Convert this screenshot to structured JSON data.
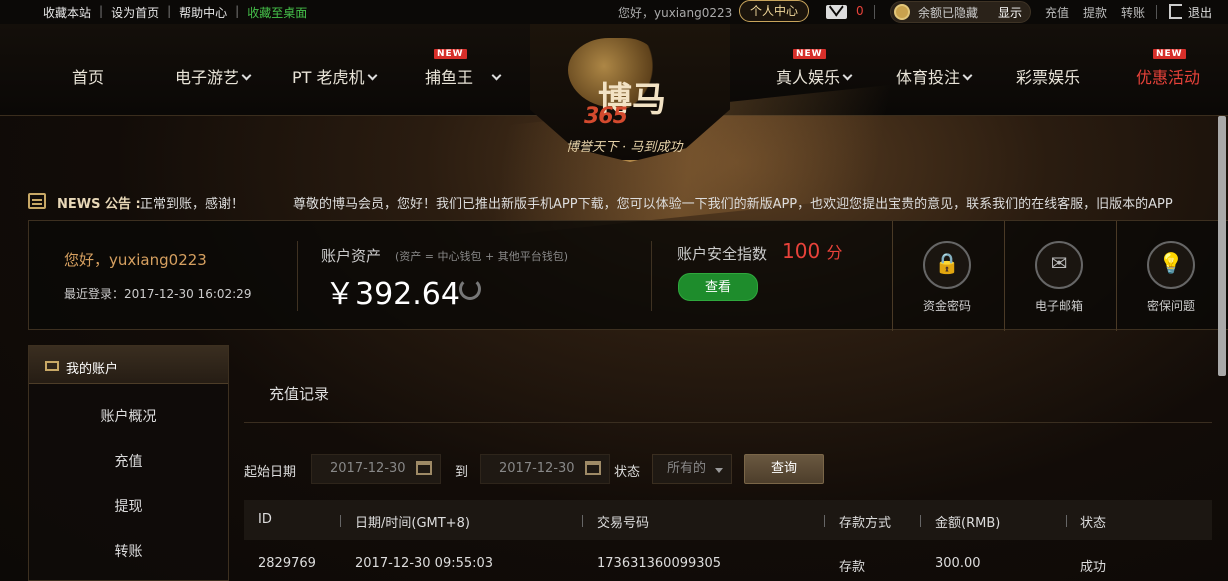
{
  "topbar": {
    "links_left": [
      "收藏本站",
      "设为首页",
      "帮助中心"
    ],
    "desktop_link": "收藏至桌面",
    "greeting": "您好，yuxiang0223",
    "personal_center": "个人中心",
    "mail_count": "0",
    "balance_hidden": "余额已隐藏",
    "show_label": "显示",
    "links_right": [
      "充值",
      "提款",
      "转账"
    ],
    "logout": "退出"
  },
  "nav": {
    "items": [
      {
        "label": "首页",
        "dropdown": false,
        "new": false
      },
      {
        "label": "电子游艺",
        "dropdown": true,
        "new": false
      },
      {
        "label": "PT 老虎机",
        "dropdown": true,
        "new": false
      },
      {
        "label": "捕鱼王",
        "dropdown": true,
        "new": true
      },
      {
        "label": "真人娱乐",
        "dropdown": true,
        "new": true
      },
      {
        "label": "体育投注",
        "dropdown": true,
        "new": false
      },
      {
        "label": "彩票娱乐",
        "dropdown": false,
        "new": false
      },
      {
        "label": "优惠活动",
        "dropdown": false,
        "new": true
      }
    ],
    "new_badge": "NEW"
  },
  "logo": {
    "main": "博马",
    "number": "365",
    "slogan": "博誉天下 · 马到成功"
  },
  "news": {
    "label": "NEWS 公告 :",
    "text1": "正常到账，感谢！",
    "text2": "尊敬的博马会员，您好！我们已推出新版手机APP下载，您可以体验一下我们的新版APP，也欢迎您提出宝贵的意见，联系我们的在线客服，旧版本的APP"
  },
  "account": {
    "hello": "您好，yuxiang0223",
    "last_login": "最近登录：2017-12-30 16:02:29",
    "assets_label": "账户资产",
    "assets_note": "(资产 = 中心钱包 + 其他平台钱包)",
    "assets_value": "￥392.64",
    "security_label": "账户安全指数",
    "security_score": "100",
    "security_unit": "分",
    "view_button": "查看",
    "quick_links": [
      "资金密码",
      "电子邮箱",
      "密保问题"
    ]
  },
  "sidebar": {
    "title": "我的账户",
    "items": [
      "账户概况",
      "充值",
      "提现",
      "转账"
    ]
  },
  "main": {
    "title": "充值记录",
    "start_date_label": "起始日期",
    "start_date": "2017-12-30",
    "to_label": "到",
    "end_date": "2017-12-30",
    "status_label": "状态",
    "status_value": "所有的",
    "query_button": "查询",
    "columns": [
      "ID",
      "日期/时间(GMT+8)",
      "交易号码",
      "存款方式",
      "金额(RMB)",
      "状态"
    ],
    "rows": [
      [
        "2829769",
        "2017-12-30 09:55:03",
        "173631360099305",
        "存款",
        "300.00",
        "成功"
      ]
    ]
  },
  "colors": {
    "accent_red": "#e8423a",
    "accent_gold": "#c8a866",
    "button_green": "#1e8c2c",
    "link_green": "#45c04a"
  }
}
